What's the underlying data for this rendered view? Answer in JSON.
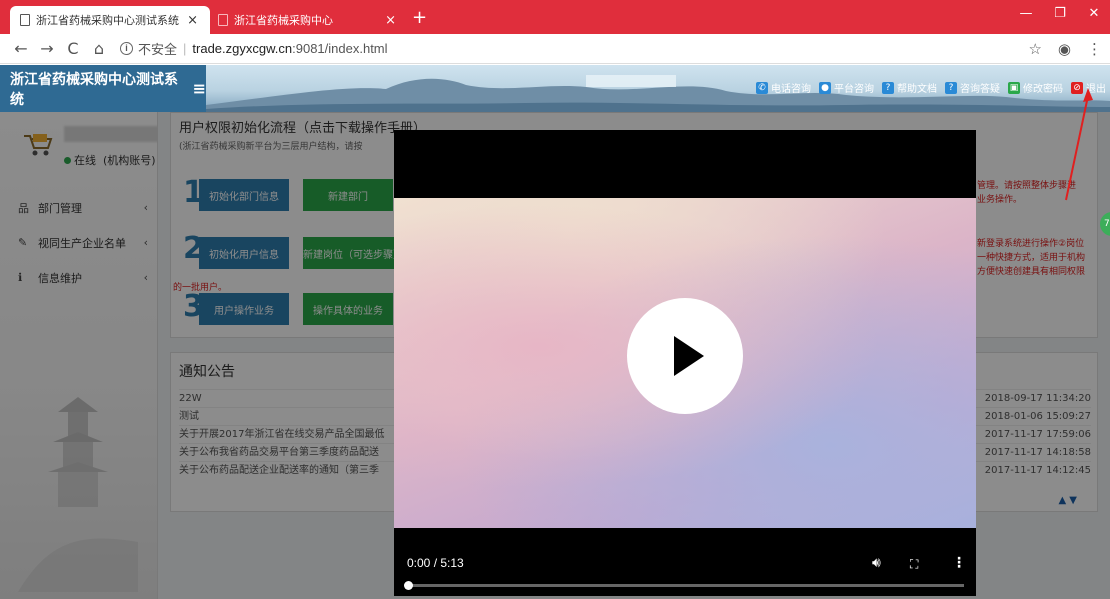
{
  "browser": {
    "tabs": [
      {
        "title": "浙江省药械采购中心测试系统",
        "active": true
      },
      {
        "title": "浙江省药械采购中心",
        "active": false
      }
    ],
    "new_tab": "+",
    "url_security": "不安全",
    "url_host": "trade.zgyxcgw.cn",
    "url_path": ":9081/index.html",
    "colors": {
      "tabbar": "#e02e3c"
    }
  },
  "header": {
    "app_title": "浙江省药械采购中心测试系统",
    "links": [
      {
        "label": "电话咨询",
        "icon": "phone-icon"
      },
      {
        "label": "平台咨询",
        "icon": "user-icon"
      },
      {
        "label": "帮助文档",
        "icon": "help-icon"
      },
      {
        "label": "咨询答疑",
        "icon": "question-icon"
      },
      {
        "label": "修改密码",
        "icon": "lock-icon"
      },
      {
        "label": "退出",
        "icon": "power-icon"
      }
    ]
  },
  "sidebar": {
    "status": "在线",
    "account_type": "(机构账号)",
    "menu": [
      {
        "label": "部门管理",
        "icon": "sitemap-icon"
      },
      {
        "label": "视同生产企业名单",
        "icon": "edit-icon"
      },
      {
        "label": "信息维护",
        "icon": "info-icon"
      }
    ]
  },
  "main": {
    "flow_title": "用户权限初始化流程（点击下载操作手册）",
    "flow_subtitle": "(浙江省药械采购新平台为三层用户结构，请按",
    "steps": [
      {
        "num": "1",
        "buttons": [
          "初始化部门信息",
          "新建部门"
        ]
      },
      {
        "num": "2",
        "buttons": [
          "初始化用户信息",
          "新建岗位（可选步骤）"
        ]
      },
      {
        "num": "3",
        "buttons": [
          "用户操作业务",
          "操作具体的业务"
        ]
      }
    ],
    "first_batch_text": "的一批用户。",
    "right_notes": [
      "管理。请按照整体步骤进",
      "业务操作。",
      "新登录系统进行操作②岗位",
      "一种快捷方式，适用于机构",
      "方便快速创建具有相同权限"
    ],
    "notice_title": "通知公告",
    "notices": [
      {
        "title": "22W",
        "date": "2018-09-17 11:34:20"
      },
      {
        "title": "测试",
        "date": "2018-01-06 15:09:27"
      },
      {
        "title": "关于开展2017年浙江省在线交易产品全国最低",
        "date": "2017-11-17 17:59:06"
      },
      {
        "title": "关于公布我省药品交易平台第三季度药品配送",
        "date": "2017-11-17 14:18:58"
      },
      {
        "title": "关于公布药品配送企业配送率的通知（第三季",
        "date": "2017-11-17 14:12:45"
      }
    ],
    "pager": "▲ ▼"
  },
  "video": {
    "current_time": "0:00",
    "duration": "5:13",
    "time_display": "0:00 / 5:13",
    "progress": 0,
    "more_label": "⋮"
  }
}
